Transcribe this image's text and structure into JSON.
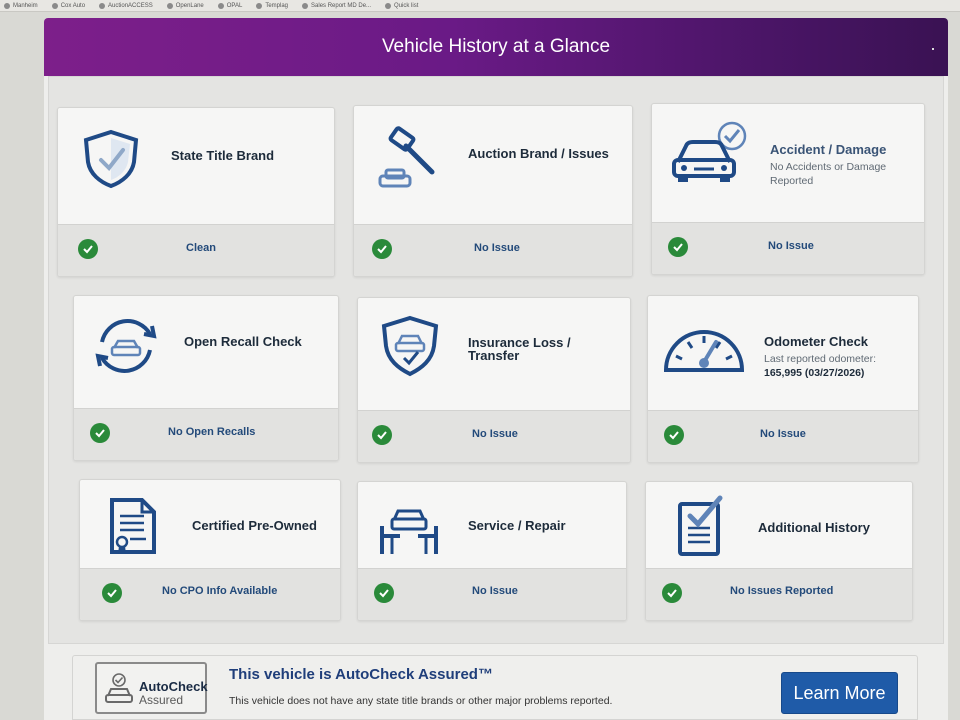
{
  "bookmarks": [
    "Manheim",
    "Cox Auto",
    "AuctionACCESS",
    "OpenLane",
    "OPAL",
    "Templag",
    "Sales Report MD De...",
    "Quick list"
  ],
  "banner": {
    "title": "Vehicle History at a Glance"
  },
  "cards": [
    {
      "title": "State Title Brand",
      "subtitle": "",
      "status": "Clean",
      "icon": "shield-check-icon"
    },
    {
      "title": "Auction Brand / Issues",
      "subtitle": "",
      "status": "No Issue",
      "icon": "gavel-icon"
    },
    {
      "title": "Accident / Damage",
      "subtitle": "No Accidents or Damage Reported",
      "status": "No Issue",
      "icon": "car-check-icon"
    },
    {
      "title": "Open Recall Check",
      "subtitle": "",
      "status": "No Open Recalls",
      "icon": "car-cycle-icon"
    },
    {
      "title": "Insurance Loss / Transfer",
      "subtitle": "",
      "status": "No Issue",
      "icon": "shield-car-icon"
    },
    {
      "title": "Odometer Check",
      "subtitle": "Last reported odometer:",
      "subtitle_value": "165,995 (03/27/2026)",
      "status": "No Issue",
      "icon": "gauge-icon"
    },
    {
      "title": "Certified Pre-Owned",
      "subtitle": "",
      "status": "No CPO Info Available",
      "icon": "certificate-icon"
    },
    {
      "title": "Service / Repair",
      "subtitle": "",
      "status": "No Issue",
      "icon": "car-lift-icon"
    },
    {
      "title": "Additional History",
      "subtitle": "",
      "status": "No Issues Reported",
      "icon": "clipboard-check-icon"
    }
  ],
  "footer": {
    "badge_title": "AutoCheck",
    "badge_sub": "Assured",
    "assured_title": "This vehicle is AutoCheck Assured™",
    "assured_desc": "This vehicle does not have any state title brands or other major problems reported.",
    "learn_more": "Learn More"
  },
  "colors": {
    "banner_start": "#7d1f8a",
    "banner_end": "#3a1253",
    "icon_blue": "#1f4a86",
    "check_green": "#2a8a3a",
    "button_blue": "#1f5ba8"
  }
}
